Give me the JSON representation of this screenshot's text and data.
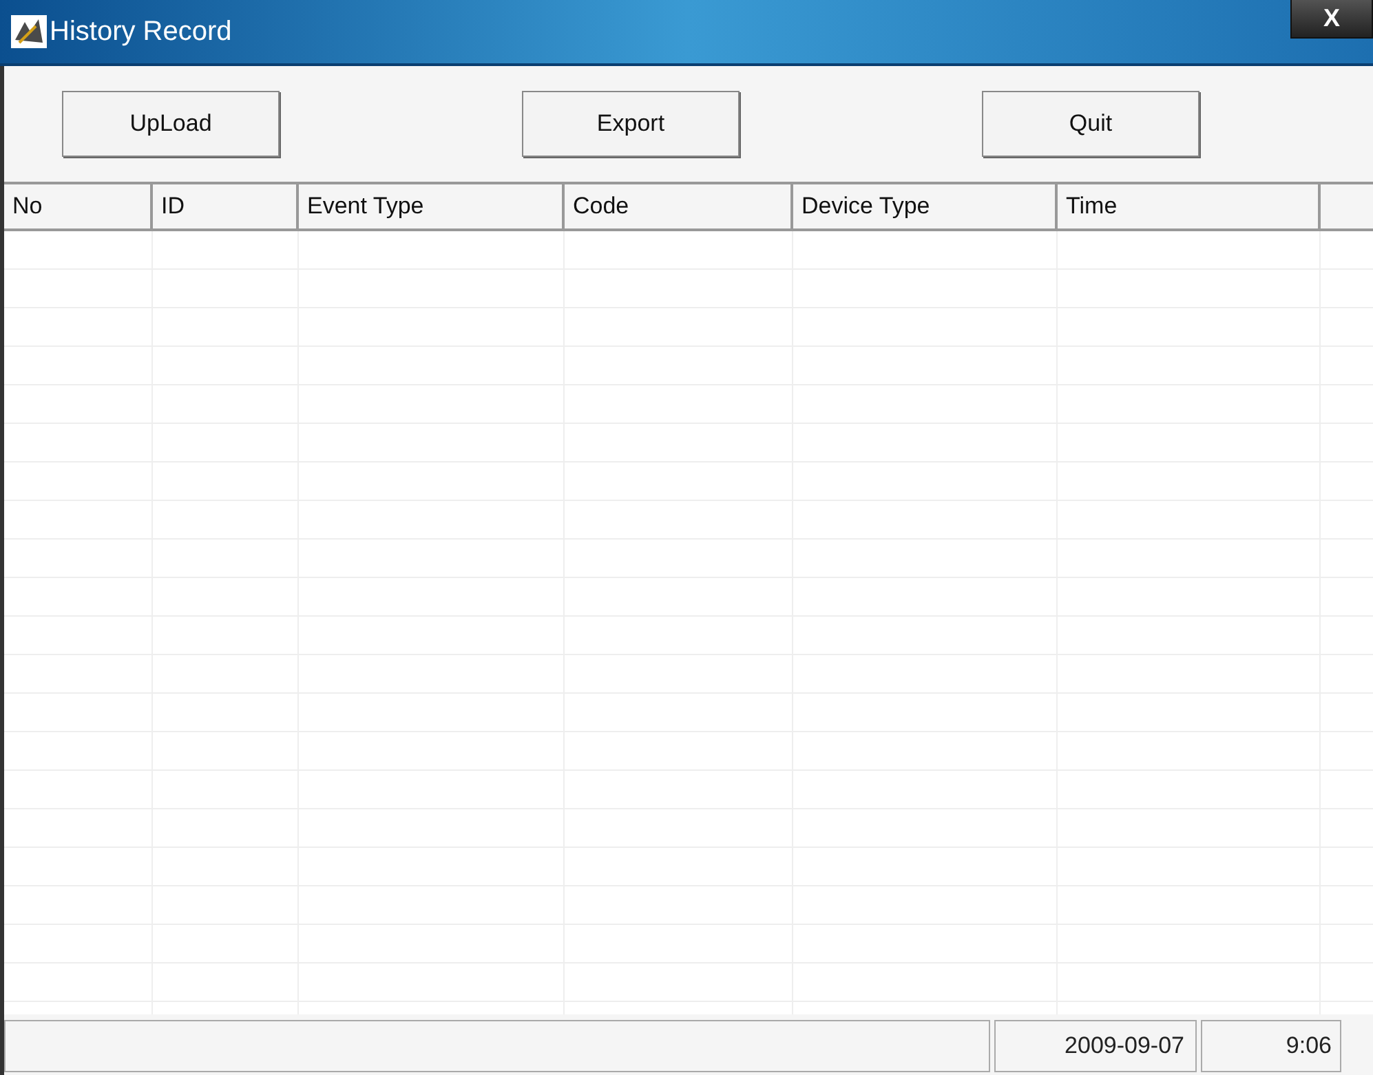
{
  "window": {
    "title": "History Record",
    "close": "X"
  },
  "buttons": [
    "UpLoad",
    "Export",
    "Quit"
  ],
  "table": {
    "columns": [
      "No",
      "ID",
      "Event Type",
      "Code",
      "Device Type",
      "Time"
    ]
  },
  "status_bar": {
    "date": "2009-09-07",
    "time": "9:06"
  }
}
